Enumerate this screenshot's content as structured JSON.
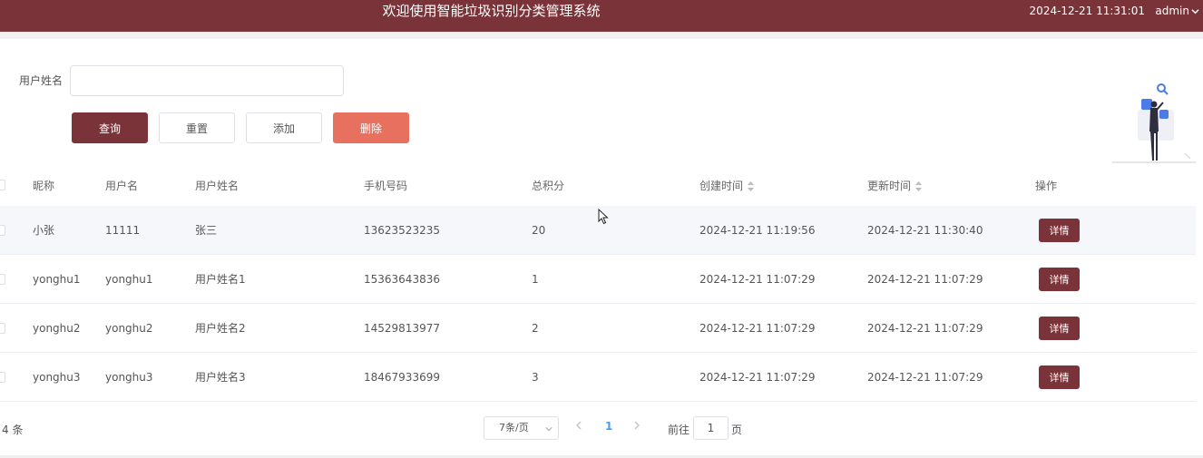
{
  "header": {
    "title": "欢迎使用智能垃圾识别分类管理系统",
    "datetime": "2024-12-21 11:31:01",
    "user": "admin"
  },
  "search": {
    "label": "用户姓名",
    "value": "",
    "placeholder": ""
  },
  "toolbar": {
    "query": "查询",
    "reset": "重置",
    "add": "添加",
    "delete": "删除"
  },
  "table": {
    "columns": [
      "昵称",
      "用户名",
      "用户姓名",
      "手机号码",
      "总积分",
      "创建时间",
      "更新时间",
      "操作"
    ],
    "detail_label": "详情",
    "rows": [
      {
        "nickname": "小张",
        "username": "11111",
        "realname": "张三",
        "phone": "13623523235",
        "points": "20",
        "created": "2024-12-21 11:19:56",
        "updated": "2024-12-21 11:30:40"
      },
      {
        "nickname": "yonghu1",
        "username": "yonghu1",
        "realname": "用户姓名1",
        "phone": "15363643836",
        "points": "1",
        "created": "2024-12-21 11:07:29",
        "updated": "2024-12-21 11:07:29"
      },
      {
        "nickname": "yonghu2",
        "username": "yonghu2",
        "realname": "用户姓名2",
        "phone": "14529813977",
        "points": "2",
        "created": "2024-12-21 11:07:29",
        "updated": "2024-12-21 11:07:29"
      },
      {
        "nickname": "yonghu3",
        "username": "yonghu3",
        "realname": "用户姓名3",
        "phone": "18467933699",
        "points": "3",
        "created": "2024-12-21 11:07:29",
        "updated": "2024-12-21 11:07:29"
      }
    ]
  },
  "pagination": {
    "total": "4 条",
    "page_size": "7条/页",
    "current_page": "1",
    "goto_label": "前往",
    "goto_value": "1",
    "goto_suffix": "页"
  },
  "colors": {
    "brand": "#7a3338",
    "danger": "#e8705f",
    "active_page": "#409eff"
  }
}
